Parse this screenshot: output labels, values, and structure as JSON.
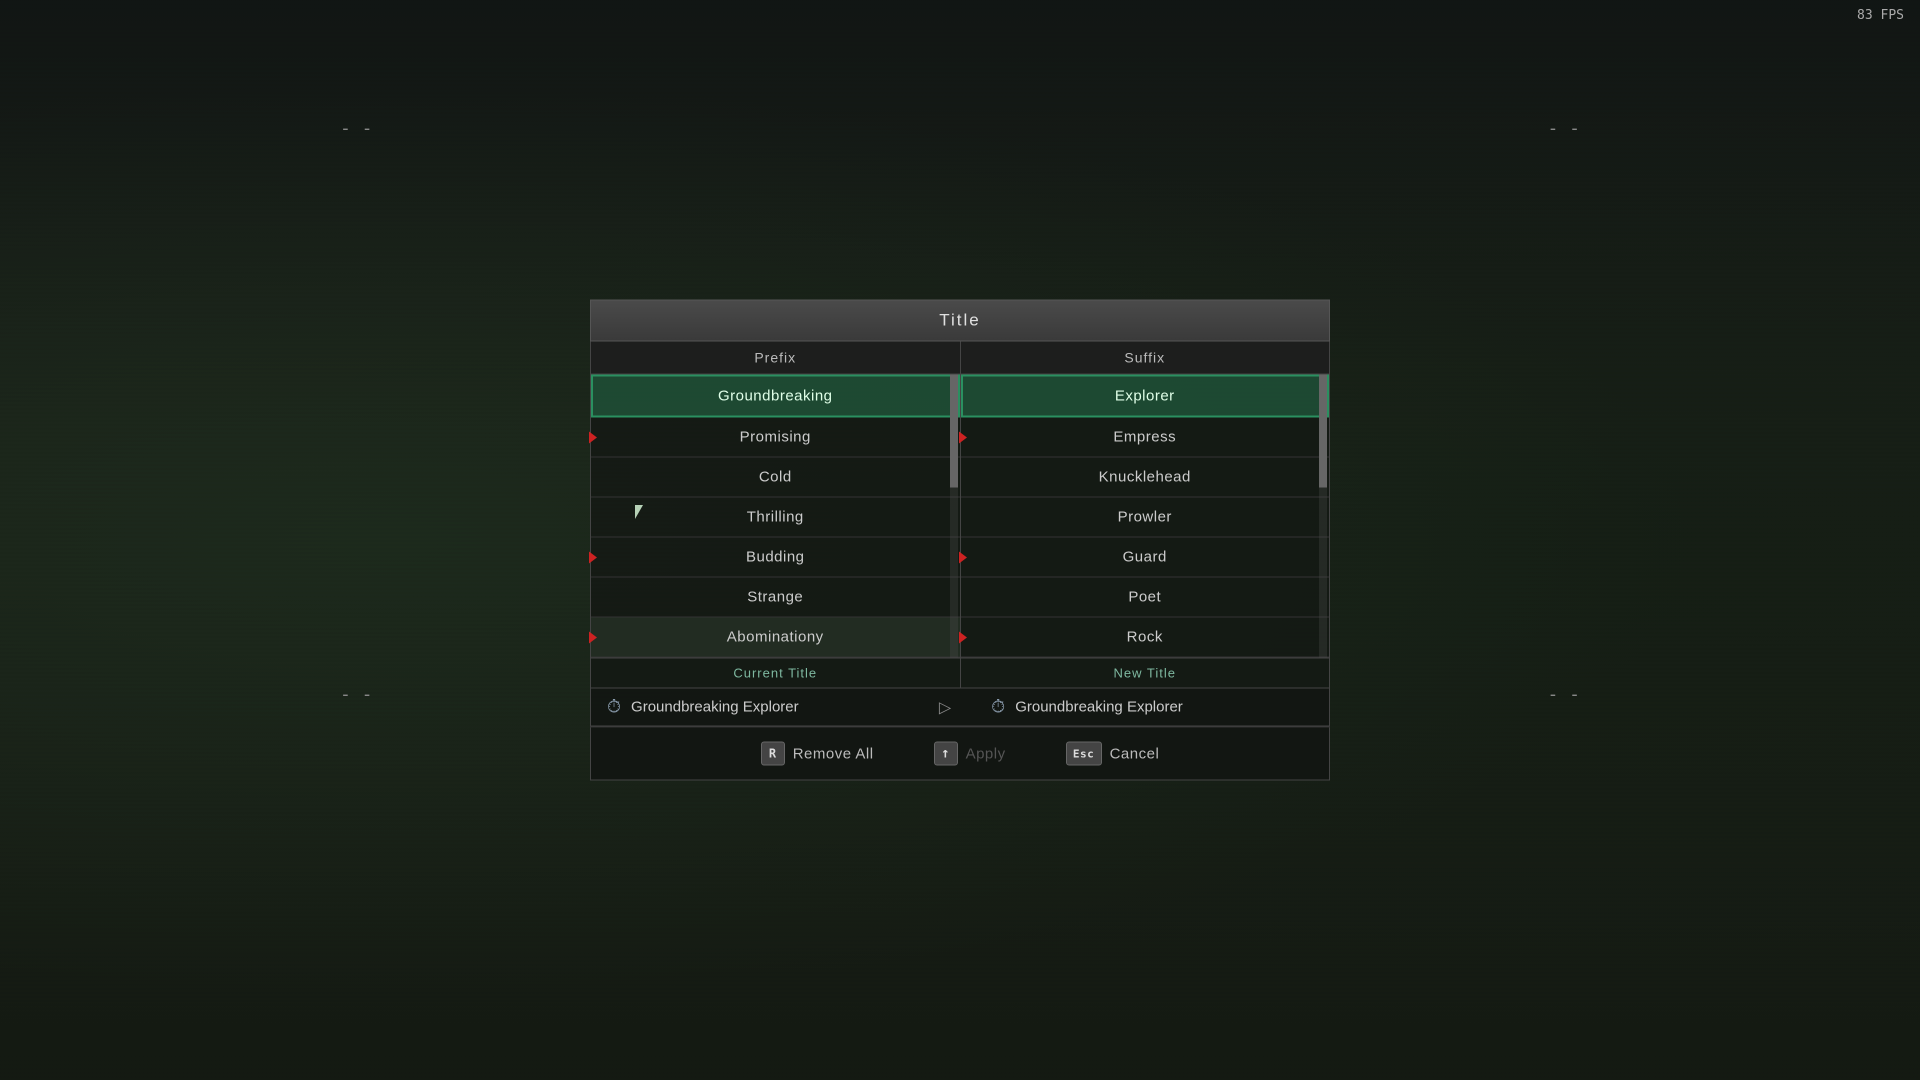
{
  "fps": "83 FPS",
  "corners": {
    "tl": "- -",
    "tr": "- -",
    "bl": "- -",
    "br": "- -"
  },
  "dialog": {
    "title": "Title",
    "prefix_header": "Prefix",
    "suffix_header": "Suffix",
    "prefix_items": [
      {
        "id": 0,
        "label": "Groundbreaking",
        "selected": true,
        "has_marker": false
      },
      {
        "id": 1,
        "label": "Promising",
        "selected": false,
        "has_marker": true
      },
      {
        "id": 2,
        "label": "Cold",
        "selected": false,
        "has_marker": false
      },
      {
        "id": 3,
        "label": "Thrilling",
        "selected": false,
        "has_marker": false
      },
      {
        "id": 4,
        "label": "Budding",
        "selected": false,
        "has_marker": true
      },
      {
        "id": 5,
        "label": "Strange",
        "selected": false,
        "has_marker": false
      },
      {
        "id": 6,
        "label": "Abominationy",
        "selected": false,
        "has_marker": true,
        "hovered": true
      }
    ],
    "suffix_items": [
      {
        "id": 0,
        "label": "Explorer",
        "selected": true,
        "has_marker": false
      },
      {
        "id": 1,
        "label": "Empress",
        "selected": false,
        "has_marker": true
      },
      {
        "id": 2,
        "label": "Knucklehead",
        "selected": false,
        "has_marker": false
      },
      {
        "id": 3,
        "label": "Prowler",
        "selected": false,
        "has_marker": false
      },
      {
        "id": 4,
        "label": "Guard",
        "selected": false,
        "has_marker": true
      },
      {
        "id": 5,
        "label": "Poet",
        "selected": false,
        "has_marker": false
      },
      {
        "id": 6,
        "label": "Rock",
        "selected": false,
        "has_marker": true
      }
    ],
    "current_title_label": "Current Title",
    "new_title_label": "New Title",
    "current_title_value": "Groundbreaking Explorer",
    "new_title_value": "Groundbreaking Explorer",
    "buttons": {
      "remove_all": {
        "key": "R",
        "label": "Remove All"
      },
      "apply": {
        "key": "↑",
        "label": "Apply"
      },
      "cancel": {
        "key": "Esc",
        "label": "Cancel"
      }
    }
  }
}
